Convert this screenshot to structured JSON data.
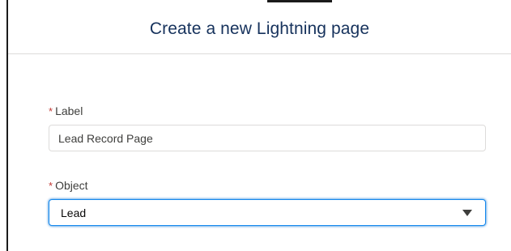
{
  "dialog": {
    "title": "Create a new Lightning page"
  },
  "fields": {
    "label": {
      "required_mark": "*",
      "label": "Label",
      "value": "Lead Record Page"
    },
    "object": {
      "required_mark": "*",
      "label": "Object",
      "selected": "Lead",
      "icon": "chevron-down-icon"
    }
  },
  "colors": {
    "title": "#16325c",
    "required": "#c23934",
    "focus_border": "#1589ee"
  }
}
